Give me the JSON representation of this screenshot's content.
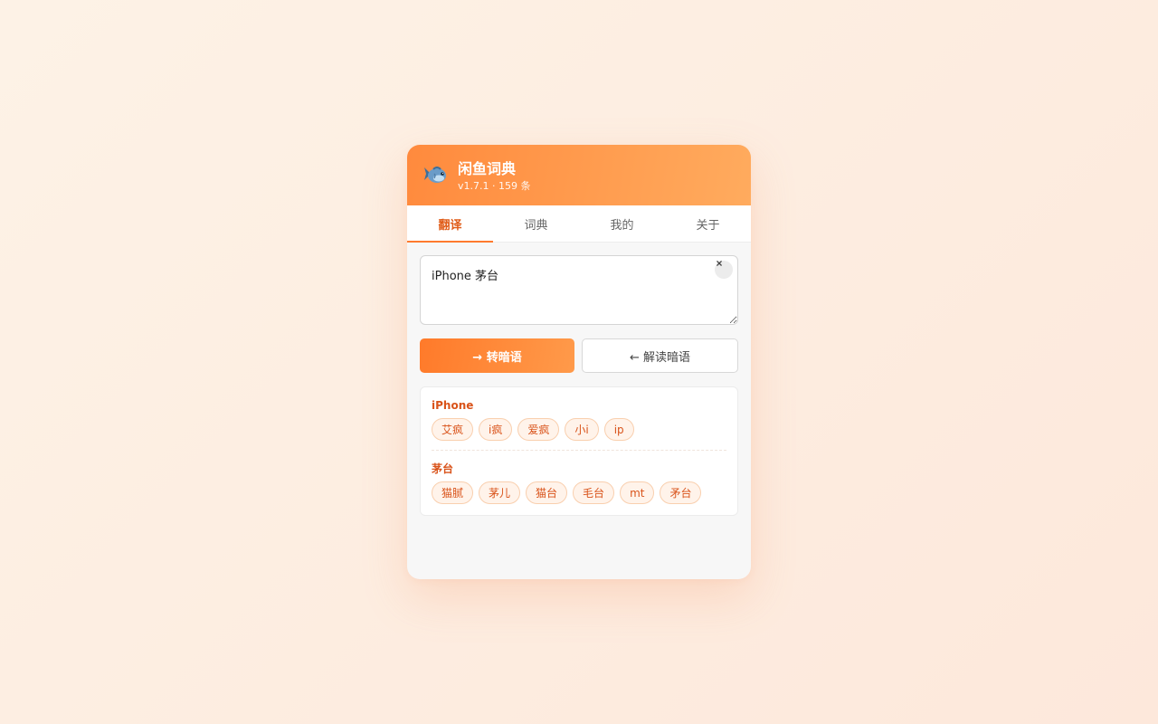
{
  "header": {
    "logo_icon": "fish-icon",
    "title": "闲鱼词典",
    "meta": "v1.7.1 · 159 条"
  },
  "tabs": [
    {
      "label": "翻译",
      "active": true
    },
    {
      "label": "词典",
      "active": false
    },
    {
      "label": "我的",
      "active": false
    },
    {
      "label": "关于",
      "active": false
    }
  ],
  "input": {
    "value": "iPhone 茅台",
    "clear_label": "×"
  },
  "actions": {
    "encode_label": "→ 转暗语",
    "decode_label": "← 解读暗语"
  },
  "results": [
    {
      "word": "iPhone",
      "slangs": [
        "艾疯",
        "i疯",
        "爱疯",
        "小i",
        "ip"
      ]
    },
    {
      "word": "茅台",
      "slangs": [
        "猫腻",
        "茅儿",
        "猫台",
        "毛台",
        "mt",
        "矛台"
      ]
    }
  ],
  "colors": {
    "accent": "#ff7a2e",
    "accent_text": "#d9531a",
    "chip_bg": "#fff3ea",
    "chip_border": "#f9cfae"
  }
}
